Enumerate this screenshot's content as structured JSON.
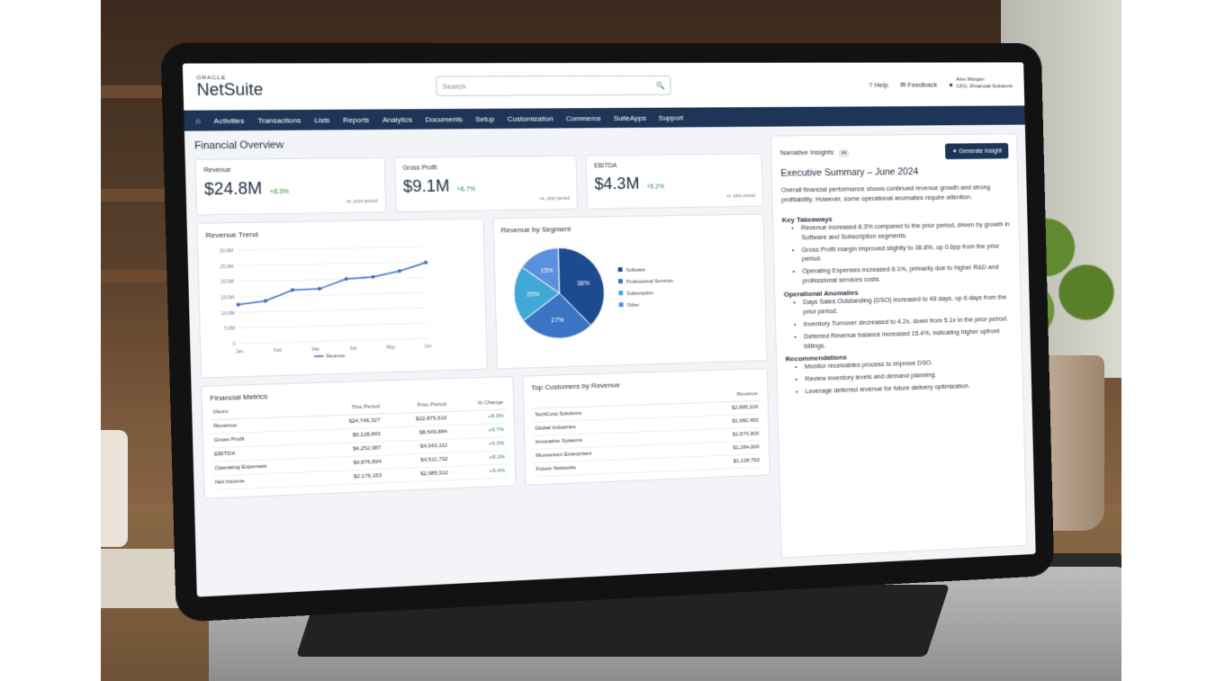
{
  "header": {
    "brand_small": "ORACLE",
    "brand_name": "NetSuite",
    "search_placeholder": "Search",
    "help": "Help",
    "feedback": "Feedback",
    "user_name": "Alex Morgan",
    "user_role": "CFO, iFinancial Solutions"
  },
  "nav": {
    "items": [
      "Activities",
      "Transactions",
      "Lists",
      "Reports",
      "Analytics",
      "Documents",
      "Setup",
      "Customization",
      "Commerce",
      "SuiteApps",
      "Support"
    ]
  },
  "dashboard": {
    "title": "Financial Overview",
    "kpis": [
      {
        "label": "Revenue",
        "value": "$24.8M",
        "change": "+8.3%",
        "sub": "vs. prior period"
      },
      {
        "label": "Gross Profit",
        "value": "$9.1M",
        "change": "+6.7%",
        "sub": "vs. prior period"
      },
      {
        "label": "EBITDA",
        "value": "$4.3M",
        "change": "+5.2%",
        "sub": "vs. prior period"
      }
    ],
    "revenue_trend_title": "Revenue Trend",
    "revenue_by_segment_title": "Revenue by Segment",
    "financial_metrics_title": "Financial Metrics",
    "top_customers_title": "Top Customers by Revenue"
  },
  "chart_data": [
    {
      "type": "line",
      "title": "Revenue Trend",
      "x": [
        "Jan",
        "Feb",
        "Mar",
        "Apr",
        "May",
        "Jun"
      ],
      "y_ticks": [
        "30.0M",
        "25.0M",
        "20.0M",
        "15.0M",
        "10.0M",
        "5.0M",
        "0"
      ],
      "ylim": [
        0,
        30
      ],
      "series": [
        {
          "name": "Revenue",
          "values": [
            12.5,
            13.5,
            16.8,
            17.0,
            20.0,
            20.5,
            22.2,
            24.8
          ]
        }
      ],
      "x_positions": [
        0,
        1,
        2,
        3,
        4,
        5,
        6,
        7
      ],
      "color": "#3b6fc4"
    },
    {
      "type": "pie",
      "title": "Revenue by Segment",
      "labels": [
        "Software",
        "Professional Services",
        "Subscription",
        "Other"
      ],
      "values": [
        38,
        27,
        20,
        15
      ],
      "colors": [
        "#1e4b8f",
        "#3a74c4",
        "#3fa8d6",
        "#5b8fe0"
      ]
    }
  ],
  "financial_metrics": {
    "columns": [
      "Metric",
      "This Period",
      "Prior Period",
      "% Change"
    ],
    "rows": [
      [
        "Revenue",
        "$24,746,327",
        "$22,875,610",
        "+8.3%"
      ],
      [
        "Gross Profit",
        "$9,128,843",
        "$8,549,884",
        "+6.7%"
      ],
      [
        "EBITDA",
        "$4,252,987",
        "$4,043,112",
        "+5.2%"
      ],
      [
        "Operating Expenses",
        "$4,876,834",
        "$4,511,732",
        "+8.1%"
      ],
      [
        "Net Income",
        "$2,176,153",
        "$2,985,512",
        "+6.4%"
      ]
    ]
  },
  "top_customers": {
    "columns": [
      "",
      "Revenue"
    ],
    "rows": [
      [
        "TechCorp Solutions",
        "$2,885,100"
      ],
      [
        "Global Industries",
        "$1,982,450"
      ],
      [
        "Innovative Systems",
        "$1,674,300"
      ],
      [
        "Momentum Enterprises",
        "$1,284,000"
      ],
      [
        "Future Networks",
        "$1,128,750"
      ]
    ]
  },
  "insights": {
    "title": "Narrative Insights",
    "badge": "AI",
    "button": "Generate Insight",
    "summary_title": "Executive Summary – June 2024",
    "summary_text": "Overall financial performance shows continued revenue growth and strong profitability. However, some operational anomalies require attention.",
    "sections": [
      {
        "title": "Key Takeaways",
        "items": [
          "Revenue increased 8.3% compared to the prior period, driven by growth in Software and Subscription segments.",
          "Gross Profit margin improved slightly to 36.8%, up 0.6pp from the prior period.",
          "Operating Expenses increased 8.1%, primarily due to higher R&D and professional services costs."
        ]
      },
      {
        "title": "Operational Anomalies",
        "items": [
          "Days Sales Outstanding (DSO) increased to 48 days, up 6 days from the prior period.",
          "Inventory Turnover decreased to 4.2x, down from 5.1x in the prior period.",
          "Deferred Revenue balance increased 15.4%, indicating higher upfront billings."
        ]
      },
      {
        "title": "Recommendations",
        "items": [
          "Monitor receivables process to improve DSO.",
          "Review inventory levels and demand planning.",
          "Leverage deferred revenue for future delivery optimization."
        ]
      }
    ]
  }
}
